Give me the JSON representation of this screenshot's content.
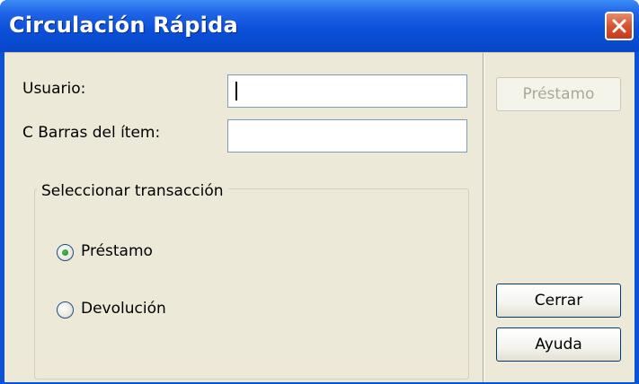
{
  "window": {
    "title": "Circulación Rápida"
  },
  "form": {
    "usuario_label": "Usuario:",
    "usuario_value": "",
    "barcode_label": "C Barras del ítem:",
    "barcode_value": ""
  },
  "transaction": {
    "legend": "Seleccionar transacción",
    "options": [
      {
        "label": "Préstamo",
        "checked": true
      },
      {
        "label": "Devolución",
        "checked": false
      }
    ]
  },
  "buttons": {
    "prestamo": {
      "label": "Préstamo",
      "enabled": false
    },
    "cerrar": {
      "label": "Cerrar",
      "enabled": true
    },
    "ayuda": {
      "label": "Ayuda",
      "enabled": true
    }
  },
  "colors": {
    "titlebar": "#0a4fd8",
    "client_bg": "#ece9d8",
    "close_button": "#d8532f"
  }
}
